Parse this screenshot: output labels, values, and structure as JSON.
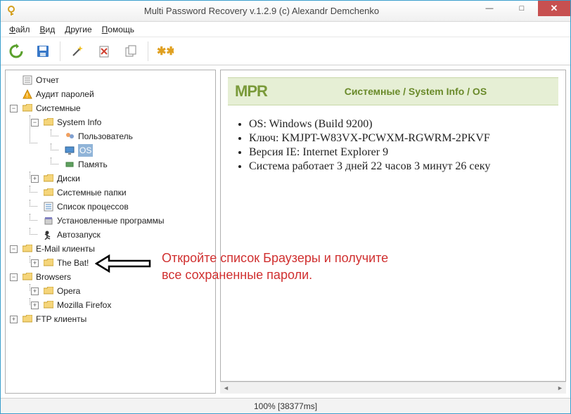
{
  "window": {
    "title": "Multi Password Recovery v.1.2.9 (c) Alexandr Demchenko",
    "min": "—",
    "max": "□",
    "close": "✕"
  },
  "menu": {
    "file": "Файл",
    "view": "Вид",
    "other": "Другие",
    "help": "Помощь"
  },
  "toolbar": {
    "refresh": "refresh",
    "save": "save",
    "wand": "wand",
    "delete": "delete",
    "copy": "copy",
    "asterisk": "asterisk"
  },
  "tree": {
    "report": "Отчет",
    "audit": "Аудит паролей",
    "system": "Системные",
    "sysinfo": "System Info",
    "user": "Пользователь",
    "os": "OS",
    "memory": "Память",
    "disks": "Диски",
    "sysfolders": "Системные папки",
    "processes": "Список процессов",
    "installed": "Установленные программы",
    "autorun": "Автозапуск",
    "email": "E-Mail клиенты",
    "thebat": "The Bat!",
    "browsers": "Browsers",
    "opera": "Opera",
    "firefox": "Mozilla Firefox",
    "ftp": "FTP клиенты"
  },
  "content": {
    "logo": "MPR",
    "crumb": "Системные / System Info / OS",
    "items": [
      "OS: Windows (Build 9200)",
      "Ключ: KMJPT-W83VX-PCWXM-RGWRM-2PKVF",
      "Версия IE: Internet Explorer 9",
      "Система работает 3 дней 22 часов 3 минут 26 секу"
    ]
  },
  "annotation": {
    "line1": "Откройте список Браузеры и получите",
    "line2": "все сохраненные пароли."
  },
  "status": "100% [38377ms]"
}
